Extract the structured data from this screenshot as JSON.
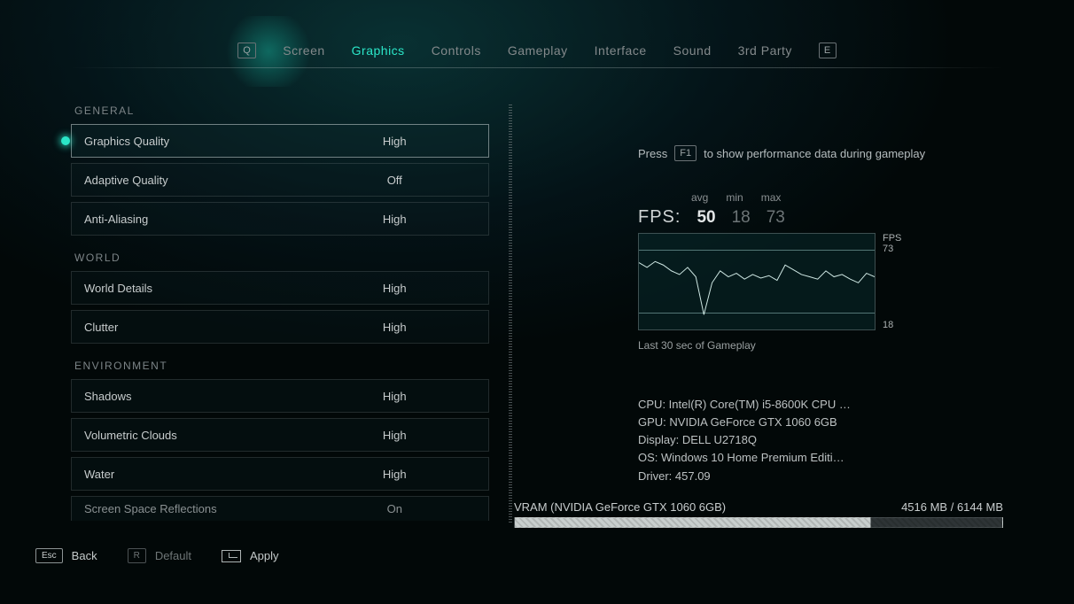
{
  "nav": {
    "prev_key": "Q",
    "next_key": "E",
    "tabs": [
      "Screen",
      "Graphics",
      "Controls",
      "Gameplay",
      "Interface",
      "Sound",
      "3rd Party"
    ],
    "active": "Graphics"
  },
  "sections": [
    {
      "title": "GENERAL",
      "rows": [
        {
          "label": "Graphics Quality",
          "value": "High",
          "selected": true
        },
        {
          "label": "Adaptive Quality",
          "value": "Off"
        },
        {
          "label": "Anti-Aliasing",
          "value": "High"
        }
      ]
    },
    {
      "title": "WORLD",
      "rows": [
        {
          "label": "World Details",
          "value": "High"
        },
        {
          "label": "Clutter",
          "value": "High"
        }
      ]
    },
    {
      "title": "ENVIRONMENT",
      "rows": [
        {
          "label": "Shadows",
          "value": "High"
        },
        {
          "label": "Volumetric Clouds",
          "value": "High"
        },
        {
          "label": "Water",
          "value": "High"
        },
        {
          "label": "Screen Space Reflections",
          "value": "On",
          "partial": true
        }
      ]
    }
  ],
  "perf": {
    "hint_prefix": "Press",
    "hint_key": "F1",
    "hint_suffix": "to show performance data during gameplay",
    "hdr_avg": "avg",
    "hdr_min": "min",
    "hdr_max": "max",
    "fps_label": "FPS:",
    "avg": "50",
    "min": "18",
    "max": "73",
    "chart_unit": "FPS",
    "chart_max": "73",
    "chart_min": "18",
    "chart_caption": "Last 30 sec of Gameplay"
  },
  "chart_data": {
    "type": "line",
    "title": "Last 30 sec of Gameplay",
    "ylabel": "FPS",
    "ylim": [
      18,
      73
    ],
    "x": [
      0,
      1,
      2,
      3,
      4,
      5,
      6,
      7,
      8,
      9,
      10,
      11,
      12,
      13,
      14,
      15,
      16,
      17,
      18,
      19,
      20,
      21,
      22,
      23,
      24,
      25,
      26,
      27,
      28,
      29
    ],
    "values": [
      62,
      58,
      63,
      60,
      55,
      52,
      58,
      50,
      18,
      45,
      55,
      50,
      53,
      48,
      52,
      49,
      51,
      47,
      60,
      56,
      52,
      50,
      48,
      55,
      50,
      52,
      48,
      45,
      53,
      50
    ]
  },
  "system": {
    "cpu_label": "CPU: ",
    "cpu": "Intel(R) Core(TM) i5-8600K CPU …",
    "gpu_label": "GPU: ",
    "gpu": "NVIDIA GeForce GTX 1060 6GB",
    "display_label": "Display: ",
    "display": "DELL U2718Q",
    "os_label": "OS: ",
    "os": "Windows 10 Home Premium Editi…",
    "driver_label": "Driver: ",
    "driver": "457.09"
  },
  "vram": {
    "label": "VRAM (NVIDIA GeForce GTX 1060 6GB)",
    "used": "4516 MB",
    "sep": " / ",
    "total": "6144 MB"
  },
  "footer": {
    "back_key": "Esc",
    "back_label": "Back",
    "default_key": "R",
    "default_label": "Default",
    "apply_label": "Apply"
  }
}
